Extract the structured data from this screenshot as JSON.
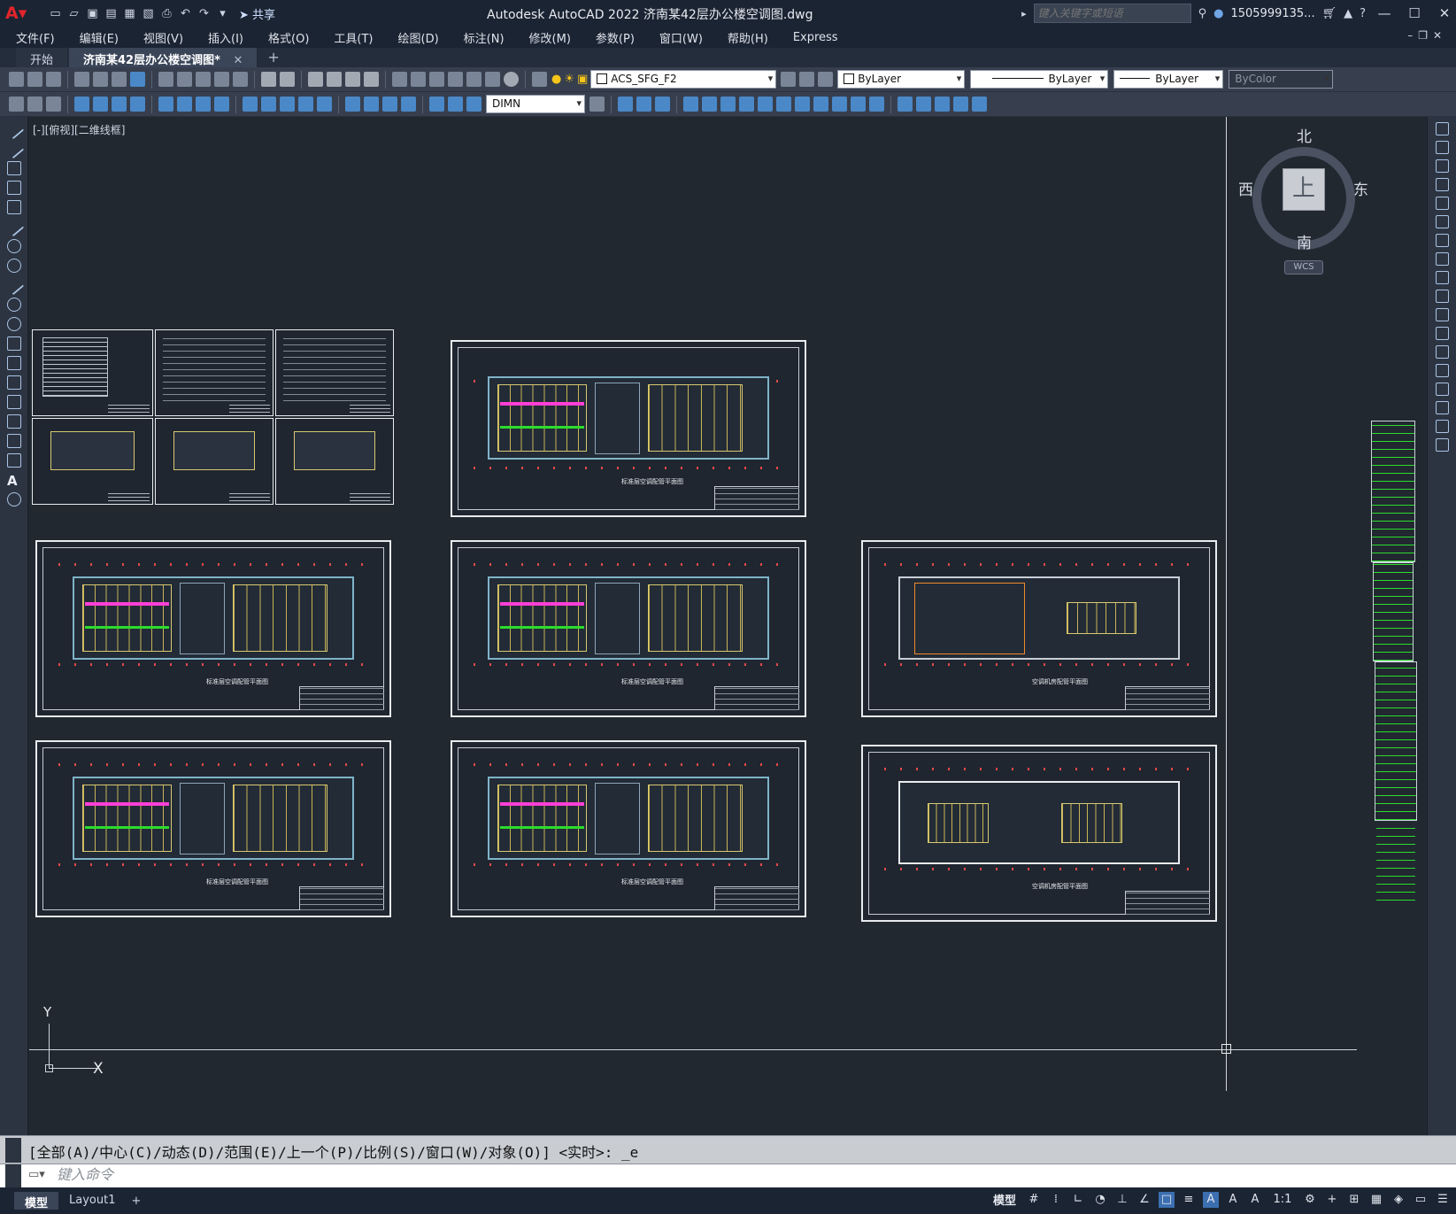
{
  "titlebar": {
    "app_title": "Autodesk AutoCAD 2022    济南某42层办公楼空调图.dwg",
    "share_label": "共享",
    "search_placeholder": "键入关键字或短语",
    "user_name": "1505999135...",
    "minimize": "—",
    "maximize": "☐",
    "close": "✕"
  },
  "menu": [
    "文件(F)",
    "编辑(E)",
    "视图(V)",
    "插入(I)",
    "格式(O)",
    "工具(T)",
    "绘图(D)",
    "标注(N)",
    "修改(M)",
    "参数(P)",
    "窗口(W)",
    "帮助(H)",
    "Express"
  ],
  "tabs": {
    "start": "开始",
    "document": "济南某42层办公楼空调图*",
    "close_glyph": "✕",
    "add_glyph": "+"
  },
  "toolbar": {
    "layer_name": "ACS_SFG_F2",
    "color": "ByLayer",
    "linetype": "ByLayer",
    "lineweight": "ByLayer",
    "plotstyle": "ByColor",
    "dimstyle": "DIMN"
  },
  "left_toolbar_text_icon": "A",
  "viewport": {
    "label": "[-][俯视][二维线框]",
    "ucs_x": "X",
    "ucs_y": "Y"
  },
  "viewcube": {
    "north": "北",
    "south": "南",
    "east": "东",
    "west": "西",
    "face": "上",
    "wcs": "WCS"
  },
  "sheets": [
    {
      "caption": "标准层空调配管平面图"
    },
    {
      "caption": "标准层空调配管平面图"
    },
    {
      "caption": "标准层空调配管平面图"
    },
    {
      "caption": "空调机房配管平面图"
    },
    {
      "caption": "标准层空调配管平面图"
    },
    {
      "caption": "标准层空调配管平面图"
    },
    {
      "caption": "空调机房配管平面图"
    }
  ],
  "command": {
    "history": "[全部(A)/中心(C)/动态(D)/范围(E)/上一个(P)/比例(S)/窗口(W)/对象(O)] <实时>: _e",
    "placeholder": "键入命令"
  },
  "layout_tabs": [
    "模型",
    "Layout1"
  ],
  "layout_add": "+",
  "status": {
    "model": "模型",
    "scale": "1:1"
  },
  "colors": {
    "canvas": "#212830",
    "chrome": "#1b2433",
    "toolbar": "#373f4e",
    "duct_magenta": "#ff3fd6",
    "pipe_green": "#2ddc2d",
    "wall_cyan": "#7fb3c8",
    "room_yellow": "#d9c870",
    "axis_red": "#e34848"
  }
}
